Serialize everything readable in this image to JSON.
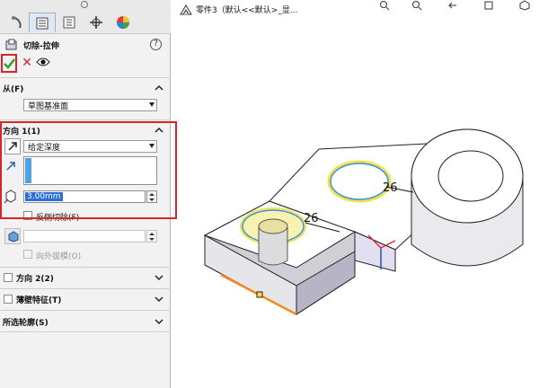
{
  "feature": {
    "title": "切除-拉伸"
  },
  "sections": {
    "from": {
      "label": "从(F)",
      "value": "草图基准面"
    },
    "direction1": {
      "label": "方向 1(1)",
      "end_condition": "给定深度",
      "depth": "3.00mm",
      "flip_label": "反侧切除(F)"
    },
    "draft": {
      "label": "向外拔模(O)"
    },
    "direction2": {
      "label": "方向 2(2)"
    },
    "thin": {
      "label": "薄壁特征(T)"
    },
    "contours": {
      "label": "所选轮廓(S)"
    }
  },
  "viewport": {
    "breadcrumb": "零件3（默认<<默认>_显...",
    "dims": [
      "26",
      "26"
    ]
  },
  "colors": {
    "highlight": "#d62728",
    "selection": "#2b6fd6",
    "accent": "#4ba3e5"
  }
}
